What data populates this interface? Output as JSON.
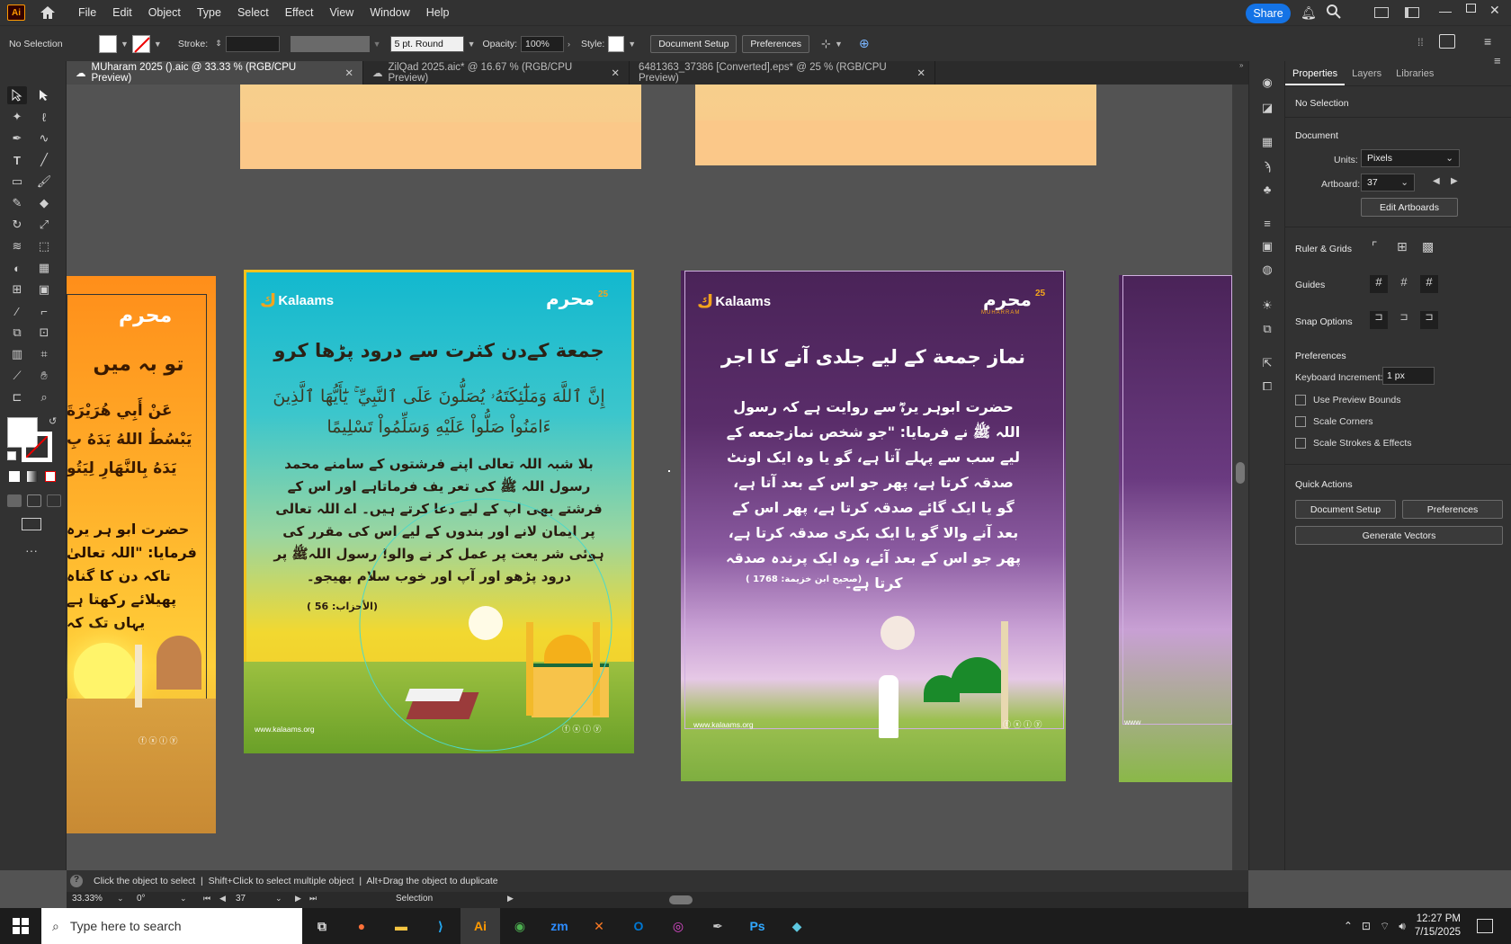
{
  "app": {
    "menu": [
      "File",
      "Edit",
      "Object",
      "Type",
      "Select",
      "Effect",
      "View",
      "Window",
      "Help"
    ],
    "share_label": "Share"
  },
  "control": {
    "selection": "No Selection",
    "stroke_label": "Stroke:",
    "brush": "5 pt. Round",
    "opacity_label": "Opacity:",
    "opacity": "100%",
    "style_label": "Style:",
    "document_setup": "Document Setup",
    "preferences": "Preferences"
  },
  "tabs": [
    {
      "label": "MUharam 2025 ().aic @ 33.33 % (RGB/CPU Preview)"
    },
    {
      "label": "ZilQad 2025.aic* @ 16.67 % (RGB/CPU Preview)"
    },
    {
      "label": "6481363_37386 [Converted].eps* @ 25 % (RGB/CPU Preview)"
    }
  ],
  "properties": {
    "tabs": [
      "Properties",
      "Layers",
      "Libraries"
    ],
    "no_selection": "No Selection",
    "document": "Document",
    "units_label": "Units:",
    "units": "Pixels",
    "artboard_label": "Artboard:",
    "artboard": "37",
    "edit_artboards": "Edit Artboards",
    "rulers": "Ruler & Grids",
    "guides": "Guides",
    "snap": "Snap Options",
    "preferences": "Preferences",
    "keyboard_label": "Keyboard Increment:",
    "keyboard": "1 px",
    "checks": [
      "Use Preview Bounds",
      "Scale Corners",
      "Scale Strokes & Effects"
    ],
    "quick_actions": "Quick Actions",
    "qa_document_setup": "Document Setup",
    "qa_preferences": "Preferences",
    "qa_generate": "Generate Vectors"
  },
  "artboards": {
    "brand": "Kalaams",
    "badge": "محرم",
    "badge_num": "25",
    "badge_sub": "MUHARRAM",
    "website": "www.kalaams.org",
    "left": {
      "title": "تو بہ میں",
      "arabic": "عَنْ أَبِي هُرَيْرَةَ",
      "arabic2": "يَبْسُطُ اللهُ يَدَهُ بِ",
      "arabic3": "يَدَهُ بِالنَّهَارِ لِيَتُو",
      "urdu1": "حضرت ابو ہر یرہ",
      "urdu2": "فرمایا: \"اللہ تعالیٰ",
      "urdu3": "تاکہ دن کا گناہ",
      "urdu4": "پھیلائے رکھتا ہے",
      "urdu5": "یہاں تک کہ"
    },
    "middle": {
      "title": "جمعة کےدن کثرت سے درود پڑھا کرو",
      "ayah1": "إِنَّ ٱللَّهَ وَمَلَٰٓئِكَتَهُۥ يُصَلُّونَ عَلَى ٱلنَّبِيِّ ۚ يَٰٓأَيُّهَا ٱلَّذِينَ",
      "ayah2": "ءَامَنُواْ صَلُّواْ عَلَيْهِ وَسَلِّمُواْ تَسْلِيمًا",
      "urdu": "بلا شبہ اللہ تعالی اپنے فرشتوں کے سامنے محمد رسول اللہ ﷺ کی تعر یف فرماتاہے اور اس کے فرشتے بھی اپ کے لیے دعا کرتے ہیں۔ اے اللہ تعالی پر ایمان لانے اور بندوں کے لیے اس کی مقرر کی ہوئی شر یعت پر عمل کر نے والو! رسول اللہﷺ پر درود پڑھو اور آپ اور خوب سلام بھیجو۔",
      "ref": "(الأحزاب: 56 )"
    },
    "right": {
      "title": "نماز جمعة کے لیے جلدی آنے کا اجر",
      "urdu": "حضرت ابوہر یرہؓ سے روایت ہے کہ رسول اللہ ﷺ نے فرمایا: \"جو شخص نمازجمعه کے لیے سب سے پہلے آتا ہے، گو یا وہ ایک اونٹ صدقہ کرتا ہے، پھر جو اس کے بعد آتا ہے، گو یا ایک گائے صدقہ کرتا ہے، پھر اس کے بعد آنے والا گو یا ایک بکری صدقہ کرتا ہے، پھر جو اس کے بعد آئے، وہ ایک پرندہ صدقہ کرتا ہے۔",
      "ref": "(صحیح ابن خزیمة: 1768 )"
    }
  },
  "status": {
    "hint": "Click the object to select  |  Shift+Click to select multiple object  |  Alt+Drag the object to duplicate",
    "zoom": "33.33%",
    "angle": "0°",
    "artboard": "37",
    "tool": "Selection"
  },
  "taskbar": {
    "search_placeholder": "Type here to search",
    "time": "12:27 PM",
    "date": "7/15/2025"
  },
  "colors": {
    "ui_dark": "#323232",
    "canvas": "#535353",
    "accent": "#1473e6",
    "illustrator": "#ff9a00"
  }
}
